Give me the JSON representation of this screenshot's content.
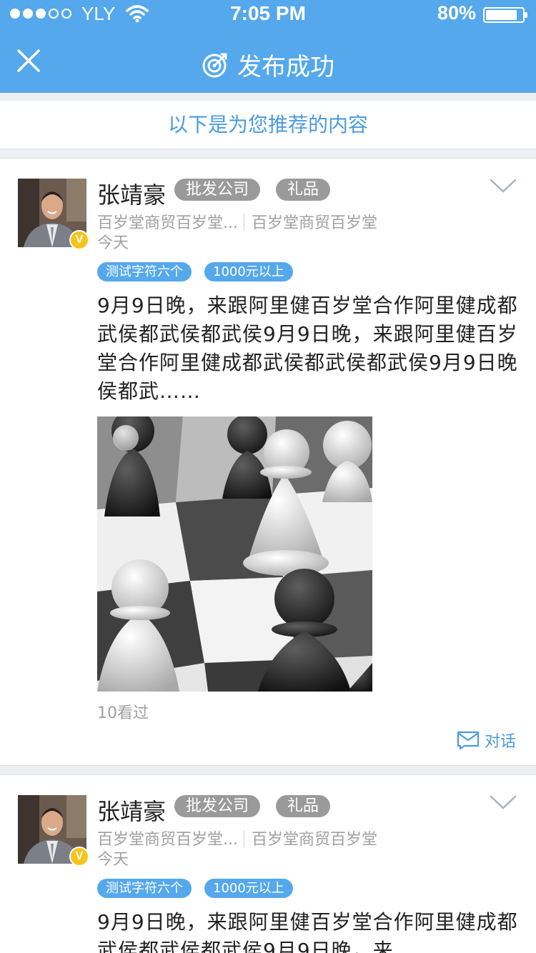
{
  "status_bar": {
    "carrier": "YLY",
    "time": "7:05 PM",
    "battery": "80%",
    "battery_level": 0.8,
    "signal_bars_filled": 3,
    "signal_bars_total": 5
  },
  "nav": {
    "title": "发布成功",
    "close_icon": "close-icon",
    "title_icon": "target-icon"
  },
  "recommend_header": "以下是为您推荐的内容",
  "posts": [
    {
      "author": "张靖豪",
      "verified_badge": "V",
      "tags": [
        "批发公司",
        "礼品"
      ],
      "company_short": "百岁堂商贸百岁堂...",
      "company": "百岁堂商贸百岁堂",
      "date": "今天",
      "labels": [
        "测试字符六个",
        "1000元以上"
      ],
      "content": "9月9日晚，来跟阿里健百岁堂合作阿里健成都武侯都武侯都武侯9月9日晚，来跟阿里健百岁堂合作阿里健成都武侯都武侯都武侯9月9日晚侯都武……",
      "image": "chess-pawns-photo",
      "views": "10看过",
      "action": "对话"
    },
    {
      "author": "张靖豪",
      "verified_badge": "V",
      "tags": [
        "批发公司",
        "礼品"
      ],
      "company_short": "百岁堂商贸百岁堂...",
      "company": "百岁堂商贸百岁堂",
      "date": "今天",
      "labels": [
        "测试字符六个",
        "1000元以上"
      ],
      "content": "9月9日晚，来跟阿里健百岁堂合作阿里健成都武侯都武侯都武侯9月9日晚，来"
    }
  ],
  "colors": {
    "brand_blue": "#55a8ec",
    "link_blue": "#4a9be0",
    "tag_gray": "#9a9a9a",
    "verified_yellow": "#f7c41b"
  }
}
